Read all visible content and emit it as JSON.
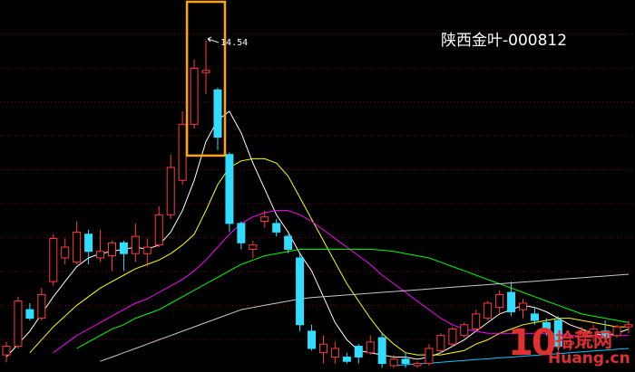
{
  "stock": {
    "title": "陕西金叶-000812"
  },
  "peak_label": "14.54",
  "colors": {
    "background": "#000000",
    "up": "#ff3c3c",
    "down": "#32dcff",
    "grid": "#7a0000",
    "highlight_box": "#ffa500",
    "ma5": "#ffffff",
    "ma10": "#ffff00",
    "ma20": "#ff00ff",
    "ma30": "#00ff00",
    "ma60": "#c8c8c8",
    "ma120": "#00c8ff"
  },
  "watermark": {
    "number": "10",
    "chinese": "拾荒网",
    "english": "Huang.cn"
  },
  "chart_data": {
    "type": "candlestick",
    "title": "陕西金叶-000812",
    "ylim": [
      7.0,
      15.4
    ],
    "grid": true,
    "peak_annotation": {
      "value": 14.54,
      "label": "14.54"
    },
    "highlight_candles": [
      16,
      18
    ],
    "candles": [
      {
        "o": 7.25,
        "h": 7.55,
        "l": 7.08,
        "c": 7.45
      },
      {
        "o": 7.45,
        "h": 8.6,
        "l": 7.4,
        "c": 8.5
      },
      {
        "o": 8.3,
        "h": 8.45,
        "l": 8.05,
        "c": 8.1
      },
      {
        "o": 8.1,
        "h": 8.8,
        "l": 8.05,
        "c": 8.65
      },
      {
        "o": 8.95,
        "h": 10.05,
        "l": 8.85,
        "c": 9.95
      },
      {
        "o": 9.5,
        "h": 9.95,
        "l": 9.35,
        "c": 9.75
      },
      {
        "o": 9.4,
        "h": 10.35,
        "l": 9.35,
        "c": 10.1
      },
      {
        "o": 10.05,
        "h": 10.15,
        "l": 9.35,
        "c": 9.65
      },
      {
        "o": 9.5,
        "h": 10.15,
        "l": 9.4,
        "c": 9.65
      },
      {
        "o": 9.55,
        "h": 9.9,
        "l": 9.2,
        "c": 9.85
      },
      {
        "o": 9.85,
        "h": 9.9,
        "l": 9.2,
        "c": 9.6
      },
      {
        "o": 9.6,
        "h": 10.3,
        "l": 9.4,
        "c": 10.0
      },
      {
        "o": 9.6,
        "h": 9.95,
        "l": 9.3,
        "c": 9.75
      },
      {
        "o": 9.8,
        "h": 10.7,
        "l": 9.75,
        "c": 10.5
      },
      {
        "o": 10.5,
        "h": 11.9,
        "l": 10.4,
        "c": 11.6
      },
      {
        "o": 11.3,
        "h": 12.9,
        "l": 11.2,
        "c": 12.6
      },
      {
        "o": 12.6,
        "h": 14.1,
        "l": 12.5,
        "c": 13.9
      },
      {
        "o": 13.8,
        "h": 14.54,
        "l": 13.3,
        "c": 13.85
      },
      {
        "o": 13.4,
        "h": 13.45,
        "l": 12.0,
        "c": 12.3
      },
      {
        "o": 11.9,
        "h": 11.95,
        "l": 10.1,
        "c": 10.3
      },
      {
        "o": 10.3,
        "h": 10.35,
        "l": 9.7,
        "c": 9.85
      },
      {
        "o": 9.7,
        "h": 9.9,
        "l": 9.5,
        "c": 9.8
      },
      {
        "o": 10.35,
        "h": 10.6,
        "l": 10.2,
        "c": 10.45
      },
      {
        "o": 10.3,
        "h": 10.4,
        "l": 10.0,
        "c": 10.1
      },
      {
        "o": 10.0,
        "h": 10.05,
        "l": 9.6,
        "c": 9.7
      },
      {
        "o": 9.5,
        "h": 9.6,
        "l": 7.8,
        "c": 7.95
      },
      {
        "o": 7.8,
        "h": 7.95,
        "l": 7.35,
        "c": 7.4
      },
      {
        "o": 7.3,
        "h": 7.7,
        "l": 7.05,
        "c": 7.5
      },
      {
        "o": 7.2,
        "h": 7.55,
        "l": 7.05,
        "c": 7.4
      },
      {
        "o": 7.2,
        "h": 7.3,
        "l": 7.05,
        "c": 7.1
      },
      {
        "o": 7.45,
        "h": 7.5,
        "l": 7.05,
        "c": 7.2
      },
      {
        "o": 7.3,
        "h": 7.7,
        "l": 7.25,
        "c": 7.55
      },
      {
        "o": 7.65,
        "h": 7.75,
        "l": 6.95,
        "c": 7.05
      },
      {
        "o": 7.0,
        "h": 7.25,
        "l": 6.95,
        "c": 7.15
      },
      {
        "o": 7.15,
        "h": 7.3,
        "l": 6.95,
        "c": 7.05
      },
      {
        "o": 7.0,
        "h": 7.1,
        "l": 6.95,
        "c": 7.05
      },
      {
        "o": 7.05,
        "h": 7.5,
        "l": 7.0,
        "c": 7.4
      },
      {
        "o": 7.35,
        "h": 7.75,
        "l": 7.3,
        "c": 7.7
      },
      {
        "o": 7.5,
        "h": 7.9,
        "l": 7.45,
        "c": 7.85
      },
      {
        "o": 7.7,
        "h": 8.0,
        "l": 7.65,
        "c": 7.95
      },
      {
        "o": 7.85,
        "h": 8.3,
        "l": 7.8,
        "c": 8.2
      },
      {
        "o": 8.1,
        "h": 8.5,
        "l": 8.05,
        "c": 8.45
      },
      {
        "o": 8.35,
        "h": 8.75,
        "l": 8.2,
        "c": 8.65
      },
      {
        "o": 8.7,
        "h": 8.95,
        "l": 8.15,
        "c": 8.25
      },
      {
        "o": 8.3,
        "h": 8.55,
        "l": 8.1,
        "c": 8.45
      },
      {
        "o": 8.2,
        "h": 8.35,
        "l": 7.95,
        "c": 8.05
      },
      {
        "o": 8.0,
        "h": 8.1,
        "l": 7.7,
        "c": 7.8
      },
      {
        "o": 8.05,
        "h": 8.15,
        "l": 7.35,
        "c": 7.45
      },
      {
        "o": 7.5,
        "h": 7.65,
        "l": 7.35,
        "c": 7.55
      },
      {
        "o": 7.5,
        "h": 7.9,
        "l": 7.45,
        "c": 7.8
      },
      {
        "o": 7.7,
        "h": 7.95,
        "l": 7.55,
        "c": 7.85
      },
      {
        "o": 7.8,
        "h": 8.05,
        "l": 7.6,
        "c": 7.65
      },
      {
        "o": 7.7,
        "h": 7.95,
        "l": 7.65,
        "c": 7.9
      },
      {
        "o": 7.9,
        "h": 8.05,
        "l": 7.75,
        "c": 7.95
      }
    ],
    "moving_averages": [
      {
        "name": "MA5",
        "color": "#ffffff",
        "values": [
          7.2,
          7.5,
          7.8,
          8.2,
          8.6,
          8.95,
          9.3,
          9.5,
          9.6,
          9.65,
          9.7,
          9.75,
          9.7,
          9.8,
          10.1,
          10.6,
          11.3,
          12.2,
          12.7,
          12.9,
          12.4,
          11.7,
          11.1,
          10.5,
          10.1,
          9.6,
          9.2,
          8.6,
          8.0,
          7.6,
          7.35,
          7.3,
          7.25,
          7.2,
          7.2,
          7.15,
          7.2,
          7.3,
          7.45,
          7.6,
          7.8,
          8.0,
          8.2,
          8.3,
          8.4,
          8.35,
          8.25,
          8.1,
          7.95,
          7.85,
          7.75,
          7.7,
          7.75,
          7.85
        ]
      },
      {
        "name": "MA10",
        "color": "#ffff00",
        "values": [
          null,
          null,
          7.3,
          7.6,
          7.9,
          8.15,
          8.4,
          8.6,
          8.8,
          8.95,
          9.1,
          9.25,
          9.35,
          9.45,
          9.6,
          9.8,
          10.05,
          10.6,
          11.2,
          11.6,
          11.75,
          11.8,
          11.8,
          11.7,
          11.4,
          10.9,
          10.4,
          9.9,
          9.4,
          8.9,
          8.5,
          8.1,
          7.75,
          7.5,
          7.3,
          7.25,
          7.25,
          7.25,
          7.3,
          7.35,
          7.5,
          7.6,
          7.75,
          7.85,
          7.95,
          8.0,
          8.05,
          8.1,
          8.1,
          8.05,
          8.0,
          7.95,
          7.9,
          7.9
        ]
      },
      {
        "name": "MA20",
        "color": "#ff00ff",
        "values": [
          null,
          null,
          null,
          null,
          7.3,
          7.5,
          7.7,
          7.85,
          8.0,
          8.15,
          8.3,
          8.45,
          8.55,
          8.7,
          8.85,
          9.0,
          9.2,
          9.45,
          9.75,
          10.05,
          10.3,
          10.45,
          10.55,
          10.6,
          10.6,
          10.5,
          10.35,
          10.15,
          9.95,
          9.75,
          9.55,
          9.35,
          9.1,
          8.9,
          8.7,
          8.5,
          8.3,
          8.1,
          7.95,
          7.85,
          7.8,
          7.75,
          7.75,
          7.75,
          7.75,
          7.75,
          7.75,
          7.75,
          7.7,
          7.7,
          7.7,
          7.7,
          7.7,
          7.7
        ]
      },
      {
        "name": "MA30",
        "color": "#00ff00",
        "values": [
          null,
          null,
          null,
          null,
          null,
          null,
          7.4,
          7.55,
          7.7,
          7.85,
          7.95,
          8.1,
          8.2,
          8.3,
          8.45,
          8.6,
          8.75,
          8.9,
          9.05,
          9.2,
          9.35,
          9.45,
          9.55,
          9.6,
          9.65,
          9.7,
          9.7,
          9.7,
          9.7,
          9.7,
          9.7,
          9.7,
          9.68,
          9.65,
          9.6,
          9.55,
          9.5,
          9.4,
          9.3,
          9.2,
          9.1,
          9.0,
          8.9,
          8.8,
          8.7,
          8.6,
          8.5,
          8.4,
          8.3,
          8.2,
          8.15,
          8.1,
          8.05,
          8.0
        ]
      },
      {
        "name": "MA60",
        "color": "#c8c8c8",
        "values": [
          null,
          null,
          null,
          null,
          null,
          null,
          null,
          null,
          7.1,
          7.2,
          7.3,
          7.4,
          7.5,
          7.6,
          7.7,
          7.8,
          7.9,
          8.0,
          8.1,
          8.2,
          8.3,
          8.35,
          8.4,
          8.45,
          8.5,
          8.55,
          8.58,
          8.6,
          8.62,
          8.64,
          8.66,
          8.68,
          8.7,
          8.72,
          8.74,
          8.76,
          8.78,
          8.8,
          8.82,
          8.84,
          8.86,
          8.88,
          8.9,
          8.92,
          8.94,
          8.96,
          8.98,
          9.0,
          9.02,
          9.04,
          9.06,
          9.08,
          9.1,
          9.12
        ]
      },
      {
        "name": "MA120",
        "color": "#00c8ff",
        "values": [
          null,
          null,
          null,
          null,
          null,
          null,
          null,
          null,
          null,
          null,
          null,
          null,
          null,
          null,
          null,
          null,
          null,
          null,
          null,
          null,
          null,
          null,
          null,
          null,
          null,
          null,
          null,
          null,
          null,
          null,
          null,
          null,
          null,
          7.0,
          7.02,
          7.04,
          7.06,
          7.08,
          7.1,
          7.12,
          7.14,
          7.16,
          7.18,
          7.2,
          7.22,
          7.24,
          7.26,
          7.28,
          7.3,
          7.32,
          7.34,
          7.36,
          7.38,
          7.4
        ]
      }
    ]
  }
}
